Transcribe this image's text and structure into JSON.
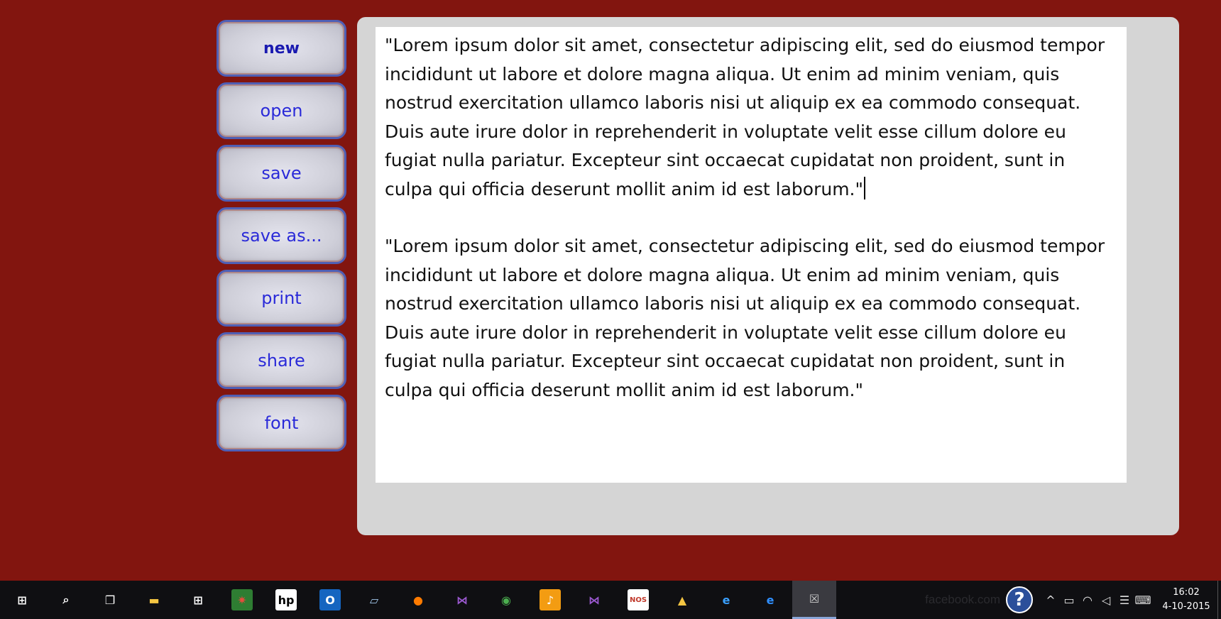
{
  "commands": [
    {
      "label": "new",
      "active": true
    },
    {
      "label": "open"
    },
    {
      "label": "save"
    },
    {
      "label": "save as..."
    },
    {
      "label": "print"
    },
    {
      "label": "share"
    },
    {
      "label": "font"
    }
  ],
  "editor": {
    "paragraphs": [
      "\"Lorem ipsum dolor sit amet, consectetur adipiscing elit, sed do eiusmod tempor incididunt ut labore et dolore magna aliqua. Ut enim ad minim veniam, quis nostrud exercitation ullamco laboris nisi ut aliquip ex ea commodo consequat. Duis aute irure dolor in reprehenderit in voluptate velit esse cillum dolore eu fugiat nulla pariatur. Excepteur sint occaecat cupidatat non proident, sunt in culpa qui officia deserunt mollit anim id est laborum.\"",
      "\"Lorem ipsum dolor sit amet, consectetur adipiscing elit, sed do eiusmod tempor incididunt ut labore et dolore magna aliqua. Ut enim ad minim veniam, quis nostrud exercitation ullamco laboris nisi ut aliquip ex ea commodo consequat. Duis aute irure dolor in reprehenderit in voluptate velit esse cillum dolore eu fugiat nulla pariatur. Excepteur sint occaecat cupidatat non proident, sunt in culpa qui officia deserunt mollit anim id est laborum.\""
    ]
  },
  "taskbar": {
    "apps": [
      {
        "name": "start-icon",
        "glyph": "⊞",
        "color": "#ffffff",
        "bg": "transparent"
      },
      {
        "name": "search-icon",
        "glyph": "⌕",
        "color": "#ffffff",
        "bg": "transparent"
      },
      {
        "name": "task-view-icon",
        "glyph": "❐",
        "color": "#ffffff",
        "bg": "transparent"
      },
      {
        "name": "file-explorer-icon",
        "glyph": "▬",
        "color": "#f4c542",
        "bg": "transparent"
      },
      {
        "name": "store-icon",
        "glyph": "⊞",
        "color": "#ffffff",
        "bg": "transparent"
      },
      {
        "name": "photo-app-icon",
        "glyph": "✷",
        "color": "#e84c3d",
        "bg": "#2e7d32"
      },
      {
        "name": "hp-icon",
        "glyph": "hp",
        "color": "#000000",
        "bg": "#ffffff"
      },
      {
        "name": "outlook-icon",
        "glyph": "O",
        "color": "#ffffff",
        "bg": "#1565c0"
      },
      {
        "name": "notepad-app-icon",
        "glyph": "▱",
        "color": "#9fc5e8",
        "bg": "transparent"
      },
      {
        "name": "firefox-icon",
        "glyph": "●",
        "color": "#ff7b00",
        "bg": "transparent"
      },
      {
        "name": "visual-studio-icon",
        "glyph": "⋈",
        "color": "#9b59d0",
        "bg": "transparent"
      },
      {
        "name": "chrome-icon",
        "glyph": "◉",
        "color": "#4caf50",
        "bg": "transparent"
      },
      {
        "name": "media-app-icon",
        "glyph": "♪",
        "color": "#ffffff",
        "bg": "#f39c12"
      },
      {
        "name": "visual-studio-2-icon",
        "glyph": "⋈",
        "color": "#9b59d0",
        "bg": "transparent"
      },
      {
        "name": "nos-icon",
        "glyph": "NOS",
        "color": "#c0392b",
        "bg": "#ffffff"
      },
      {
        "name": "folder-tools-icon",
        "glyph": "▲",
        "color": "#f4c542",
        "bg": "transparent"
      },
      {
        "name": "internet-explorer-icon",
        "glyph": "e",
        "color": "#3aa0ff",
        "bg": "transparent"
      },
      {
        "name": "edge-icon",
        "glyph": "e",
        "color": "#2f8fff",
        "bg": "transparent"
      },
      {
        "name": "running-app-icon",
        "glyph": "☒",
        "color": "#cccccc",
        "bg": "transparent",
        "active": true
      }
    ],
    "ghost_text": "facebook.com",
    "tray_icons": [
      {
        "name": "tray-expand-icon",
        "glyph": "^"
      },
      {
        "name": "battery-icon",
        "glyph": "▭"
      },
      {
        "name": "wifi-icon",
        "glyph": "◠"
      },
      {
        "name": "volume-icon",
        "glyph": "◁"
      },
      {
        "name": "action-center-icon",
        "glyph": "☰"
      },
      {
        "name": "keyboard-icon",
        "glyph": "⌨"
      }
    ],
    "clock": {
      "time": "16:02",
      "date": "4-10-2015"
    }
  }
}
